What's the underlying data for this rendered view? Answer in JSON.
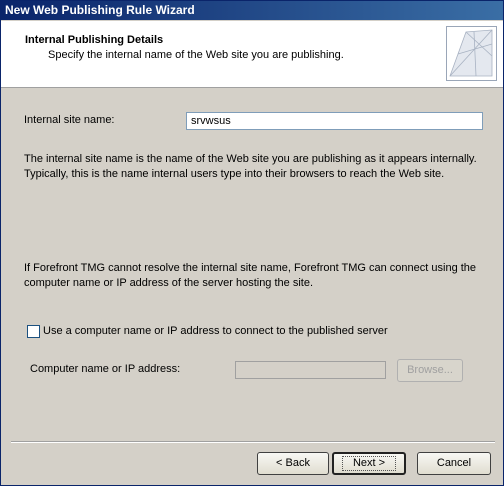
{
  "window": {
    "title": "New Web Publishing Rule Wizard"
  },
  "header": {
    "title": "Internal Publishing Details",
    "subtitle": "Specify the internal name of the Web site you are publishing."
  },
  "internal_site": {
    "label": "Internal site name:",
    "value": "srvwsus"
  },
  "description": "The internal site name is the name of the Web site you are publishing as it appears internally. Typically, this is the name internal users type into their browsers to reach the Web site.",
  "fallback_note": "If Forefront TMG cannot resolve the internal site name, Forefront TMG can connect using the computer name or IP address of the server hosting the site.",
  "use_computer_name": {
    "label": "Use a computer name or IP address to connect to the published server",
    "checked": false
  },
  "computer_name": {
    "label": "Computer name or IP address:",
    "value": "",
    "browse_label": "Browse..."
  },
  "buttons": {
    "back": "< Back",
    "next": "Next >",
    "cancel": "Cancel"
  }
}
